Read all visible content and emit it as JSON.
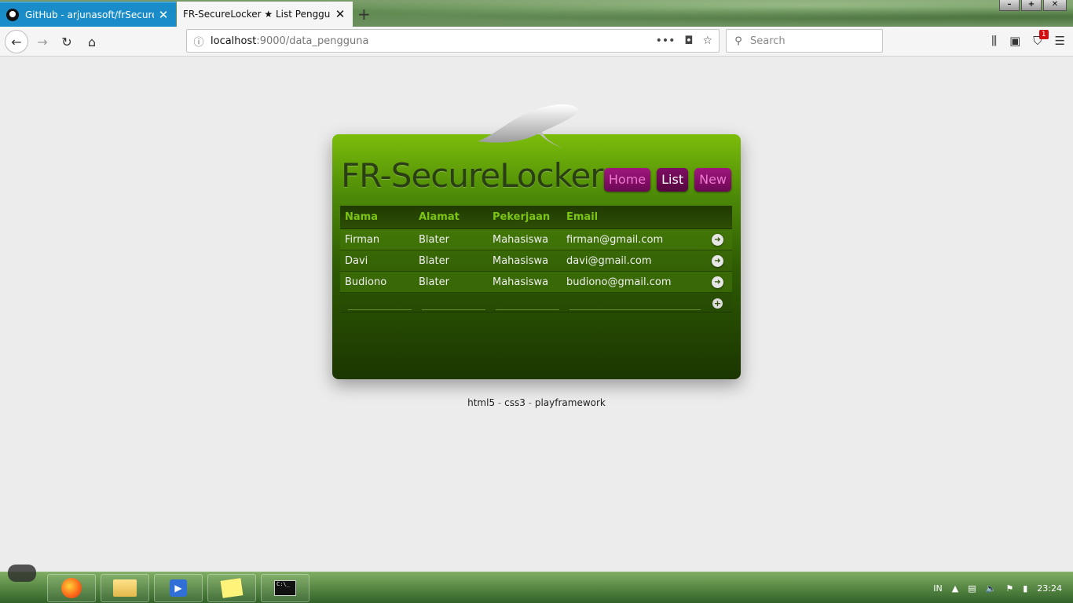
{
  "browser": {
    "tabs": [
      {
        "title": "GitHub - arjunasoft/frSecureLo",
        "active": false
      },
      {
        "title": "FR-SecureLocker ★ List Pengguna",
        "active": true
      }
    ],
    "address": {
      "host": "localhost",
      "path": ":9000/data_pengguna"
    },
    "search_placeholder": "Search",
    "badge_count": "1"
  },
  "app": {
    "title": "FR-SecureLocker",
    "nav": [
      {
        "label": "Home",
        "active": false
      },
      {
        "label": "List",
        "active": true
      },
      {
        "label": "New",
        "active": false
      }
    ]
  },
  "table": {
    "headers": [
      "Nama",
      "Alamat",
      "Pekerjaan",
      "Email"
    ],
    "rows": [
      {
        "nama": "Firman",
        "alamat": "Blater",
        "pekerjaan": "Mahasiswa",
        "email": "firman@gmail.com"
      },
      {
        "nama": "Davi",
        "alamat": "Blater",
        "pekerjaan": "Mahasiswa",
        "email": "davi@gmail.com"
      },
      {
        "nama": "Budiono",
        "alamat": "Blater",
        "pekerjaan": "Mahasiswa",
        "email": "budiono@gmail.com"
      }
    ]
  },
  "footer": {
    "a": "html5",
    "b": "css3",
    "c": "playframework",
    "sep": "-"
  },
  "taskbar": {
    "lang": "IN",
    "time": "23:24"
  },
  "colors": {
    "accent": "#7cbd0a",
    "button": "#a0177e"
  }
}
